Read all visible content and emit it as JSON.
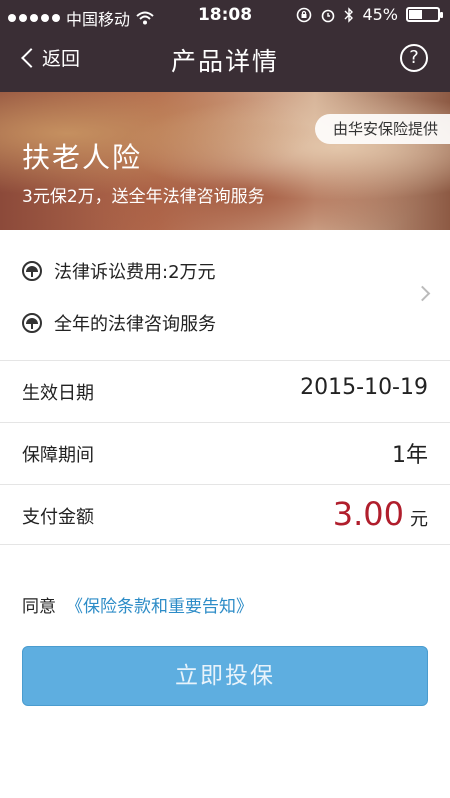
{
  "status_bar": {
    "carrier": "中国移动",
    "time": "18:08",
    "battery": "45%",
    "battery_level": 0.45
  },
  "nav": {
    "back_label": "返回",
    "title": "产品详情",
    "help_symbol": "?"
  },
  "banner": {
    "provider": "由华安保险提供",
    "title": "扶老人险",
    "subtitle": "3元保2万，送全年法律咨询服务"
  },
  "features": [
    {
      "icon": "umbrella-icon",
      "text": "法律诉讼费用:2万元"
    },
    {
      "icon": "umbrella-icon",
      "text": "全年的法律咨询服务"
    }
  ],
  "details": {
    "effective_date_label": "生效日期",
    "effective_date_value": "2015-10-19",
    "period_label": "保障期间",
    "period_value": "1年",
    "payment_label": "支付金额",
    "payment_amount": "3.00",
    "payment_unit": "元"
  },
  "agreement": {
    "prefix": "同意",
    "link": "《保险条款和重要告知》"
  },
  "cta": {
    "label": "立即投保"
  },
  "colors": {
    "nav_bg": "#3a2e35",
    "amount": "#b01e2c",
    "link": "#2d8cc7",
    "button": "#5eaee0"
  }
}
